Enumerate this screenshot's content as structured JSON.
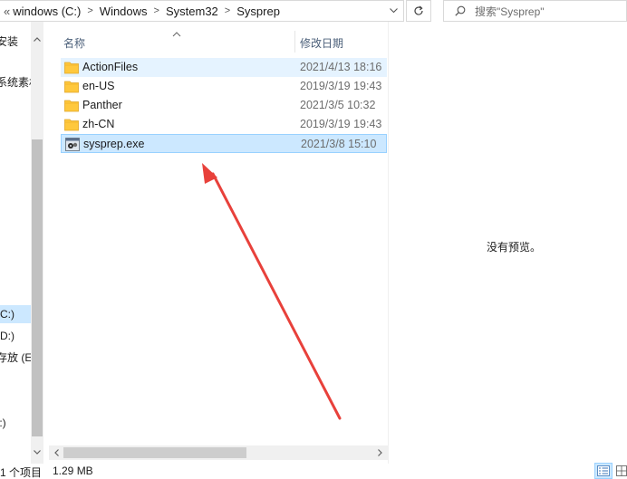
{
  "address_bar": {
    "overflow": "«",
    "crumbs": [
      "windows (C:)",
      "Windows",
      "System32",
      "Sysprep"
    ]
  },
  "search": {
    "placeholder": "搜索\"Sysprep\""
  },
  "nav_pane": {
    "items": [
      {
        "label": "安装",
        "selected": false
      },
      {
        "label": "系统素材",
        "selected": false
      },
      {
        "label": "(C:)",
        "selected": true
      },
      {
        "label": "(D:)",
        "selected": false
      },
      {
        "label": "存放 (E",
        "selected": false
      },
      {
        "label": "I:)",
        "selected": false
      }
    ]
  },
  "columns": {
    "name": "名称",
    "date": "修改日期"
  },
  "files": [
    {
      "name": "ActionFiles",
      "date": "2021/4/13 18:16",
      "type": "folder",
      "state": "hover"
    },
    {
      "name": "en-US",
      "date": "2019/3/19 19:43",
      "type": "folder",
      "state": ""
    },
    {
      "name": "Panther",
      "date": "2021/3/5 10:32",
      "type": "folder",
      "state": ""
    },
    {
      "name": "zh-CN",
      "date": "2019/3/19 19:43",
      "type": "folder",
      "state": ""
    },
    {
      "name": "sysprep.exe",
      "date": "2021/3/8 15:10",
      "type": "exe",
      "state": "selected"
    }
  ],
  "preview": {
    "message": "没有预览。"
  },
  "status_bar": {
    "count": "1 个项目",
    "size": "1.29 MB"
  },
  "colors": {
    "selection": "#cce8ff",
    "selection_border": "#99d1ff",
    "hover": "#e5f3ff",
    "folder": "#ffc83d",
    "annotation_arrow": "#e8413b"
  },
  "icons": {
    "refresh": "refresh-icon",
    "search": "search-icon",
    "folder": "folder-icon",
    "exe": "exe-icon",
    "details_view": "details-view-icon",
    "large_icons_view": "large-icons-view-icon"
  }
}
